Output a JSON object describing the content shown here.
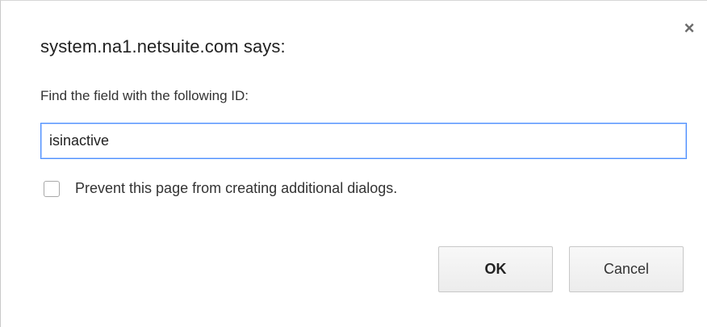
{
  "dialog": {
    "title": "system.na1.netsuite.com says:",
    "prompt": "Find the field with the following ID:",
    "input_value": "isinactive",
    "prevent_label": "Prevent this page from creating additional dialogs.",
    "prevent_checked": false,
    "close_icon": "close-icon",
    "close_glyph": "×",
    "ok_label": "OK",
    "cancel_label": "Cancel"
  },
  "colors": {
    "focus_border": "#4d90fe",
    "text": "#222222"
  }
}
